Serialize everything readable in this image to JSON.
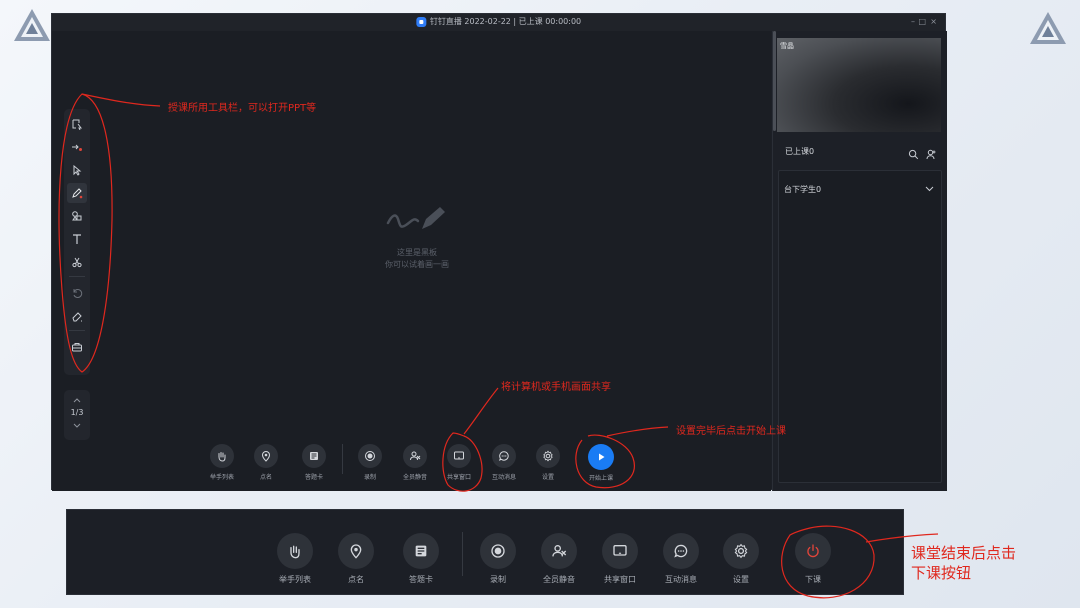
{
  "window": {
    "title": "钉钉直播 2022-02-22 | 已上课 00:00:00",
    "controls": [
      "–",
      "□",
      "×"
    ]
  },
  "toolbar": {
    "tools": [
      "select-region-icon",
      "laser-pointer-icon",
      "cursor-icon",
      "pen-icon",
      "shapes-icon",
      "text-icon",
      "scissors-icon",
      "undo-icon",
      "eraser-icon",
      "toolbox-icon"
    ],
    "active_tool": "pen-icon"
  },
  "pager": {
    "page": "1/3"
  },
  "board": {
    "hint_line1": "这里是黑板",
    "hint_line2": "你可以试着画一画"
  },
  "controls": [
    {
      "id": "raise-hand",
      "label": "举手列表",
      "icon": "hand-icon"
    },
    {
      "id": "roll-call",
      "label": "点名",
      "icon": "location-pin-icon"
    },
    {
      "id": "answer-card",
      "label": "答题卡",
      "icon": "card-icon"
    },
    {
      "id": "record",
      "label": "录制",
      "icon": "record-icon"
    },
    {
      "id": "mute-all",
      "label": "全员静音",
      "icon": "mute-icon"
    },
    {
      "id": "share-window",
      "label": "共享窗口",
      "icon": "screen-share-icon"
    },
    {
      "id": "messages",
      "label": "互动消息",
      "icon": "chat-icon"
    },
    {
      "id": "settings",
      "label": "设置",
      "icon": "gear-icon"
    },
    {
      "id": "start-class",
      "label": "开始上课",
      "icon": "play-icon"
    }
  ],
  "right_panel": {
    "video_name": "雪晶",
    "online_label": "已上课0",
    "students_label": "台下学生0"
  },
  "bottom_bar": {
    "controls": [
      {
        "id": "raise-hand",
        "label": "举手列表",
        "icon": "hand-icon"
      },
      {
        "id": "roll-call",
        "label": "点名",
        "icon": "location-pin-icon"
      },
      {
        "id": "answer-card",
        "label": "答题卡",
        "icon": "card-icon"
      },
      {
        "id": "record",
        "label": "录制",
        "icon": "record-icon"
      },
      {
        "id": "mute-all",
        "label": "全员静音",
        "icon": "mute-icon"
      },
      {
        "id": "share-window",
        "label": "共享窗口",
        "icon": "screen-share-icon"
      },
      {
        "id": "messages",
        "label": "互动消息",
        "icon": "chat-icon"
      },
      {
        "id": "settings",
        "label": "设置",
        "icon": "gear-icon"
      },
      {
        "id": "end-class",
        "label": "下课",
        "icon": "power-icon"
      }
    ]
  },
  "annotations": {
    "toolbar_note": "授课所用工具栏，可以打开PPT等",
    "share_note": "将计算机或手机画面共享",
    "start_note": "设置完毕后点击开始上课",
    "end_note_line1": "课堂结束后点击",
    "end_note_line2": "下课按钮"
  },
  "colors": {
    "annotation_red": "#e0281e",
    "accent_blue": "#1a7cf4",
    "power_red": "#e0453a",
    "window_bg": "#1c1f26"
  }
}
